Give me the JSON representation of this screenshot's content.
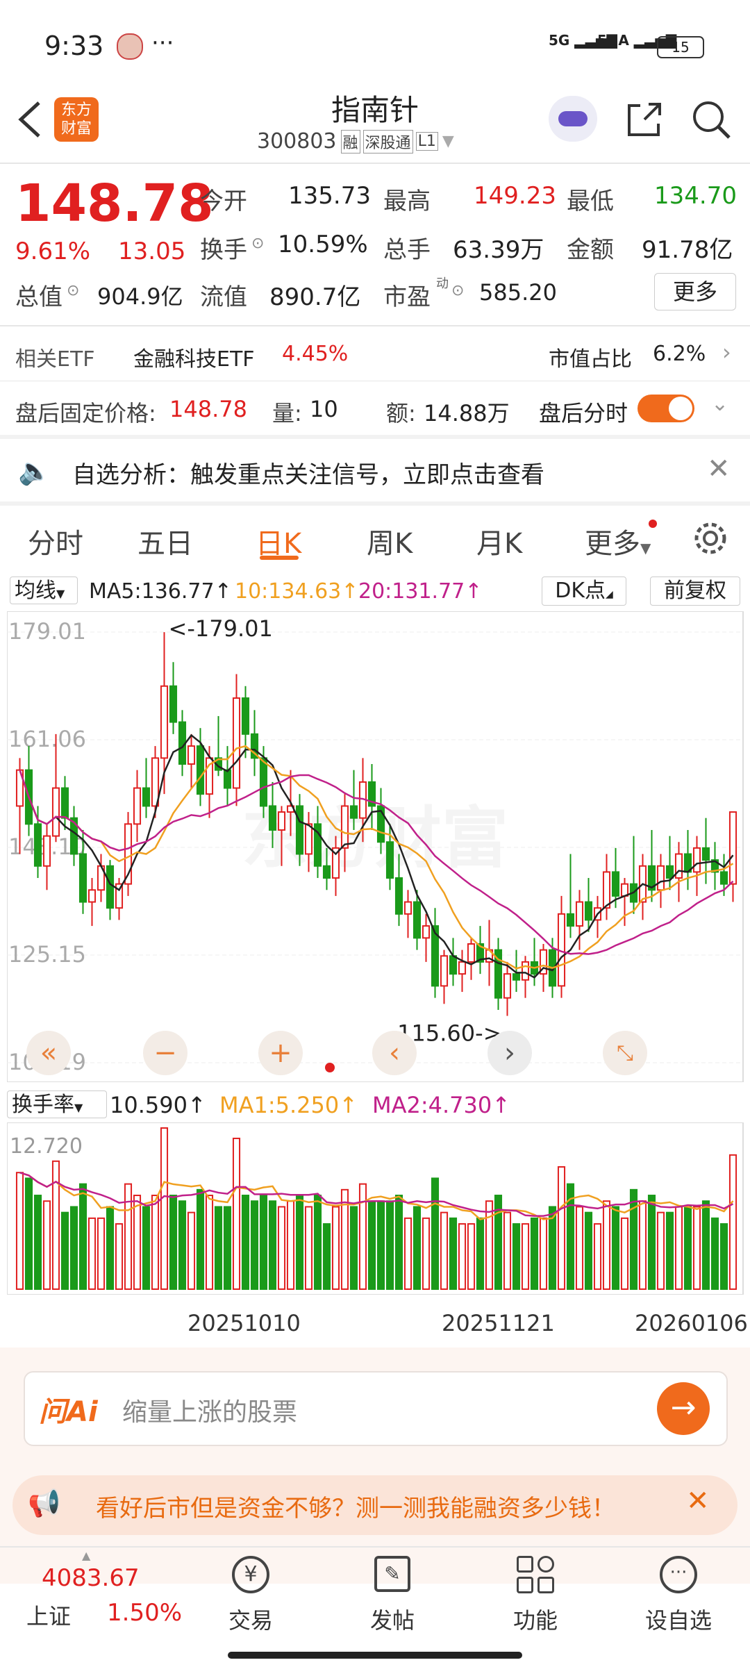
{
  "status_bar": {
    "time": "9:33",
    "dots": "···",
    "battery": "15",
    "net1": "5G",
    "net2": "5GA"
  },
  "header": {
    "logo_line1": "东方",
    "logo_line2": "财富",
    "title": "指南针",
    "code": "300803",
    "tag_rong": "融",
    "tag_market": "深股通",
    "tag_level": "L1"
  },
  "quote": {
    "price": "148.78",
    "change_pct": "9.61%",
    "change": "13.05",
    "open_label": "今开",
    "open": "135.73",
    "high_label": "最高",
    "high": "149.23",
    "low_label": "最低",
    "low": "134.70",
    "turnover_label": "换手",
    "turnover": "10.59%",
    "volume_label": "总手",
    "volume": "63.39万",
    "amount_label": "金额",
    "amount": "91.78亿",
    "mktcap_label": "总值",
    "mktcap": "904.9亿",
    "float_label": "流值",
    "float": "890.7亿",
    "pe_label": "市盈",
    "pe_sup": "动",
    "pe": "585.20",
    "more_button": "更多"
  },
  "etf": {
    "label": "相关ETF",
    "name": "金融科技ETF",
    "pct": "4.45%",
    "ratio_label": "市值占比",
    "ratio": "6.2%"
  },
  "after_hours": {
    "price_label": "盘后固定价格:",
    "price": "148.78",
    "qty_label": "量:",
    "qty": "10",
    "amt_label": "额:",
    "amt": "14.88万",
    "toggle_label": "盘后分时"
  },
  "notice": {
    "text": "自选分析：触发重点关注信号，立即点击查看"
  },
  "tabs": {
    "t1": "分时",
    "t2": "五日",
    "t3": "日K",
    "t4": "周K",
    "t5": "月K",
    "t6": "更多"
  },
  "indicator_bar": {
    "ma_select": "均线",
    "ma5": "MA5:136.77",
    "ma10": "10:134.63",
    "ma20": "20:131.77",
    "dk": "DK点",
    "adjust": "前复权"
  },
  "kline": {
    "y_labels": [
      "179.01",
      "161.06",
      "143.10",
      "125.15",
      "107.19"
    ],
    "max_label": "<-179.01",
    "min_label": "115.60->",
    "watermark": "东方财富"
  },
  "volume_panel": {
    "select": "换手率",
    "value": "10.590",
    "ma1": "MA1:5.250",
    "ma2": "MA2:4.730",
    "y_label": "12.720"
  },
  "x_axis": {
    "d1": "20251010",
    "d2": "20251121",
    "d3": "20260106"
  },
  "ask_ai": {
    "brand": "问Ai",
    "placeholder": "缩量上涨的股票"
  },
  "promo": {
    "text": "看好后市但是资金不够？测一测我能融资多少钱！"
  },
  "bottom_nav": {
    "index_value": "4083.67",
    "index_name": "上证",
    "index_pct": "1.50%",
    "trade": "交易",
    "post": "发帖",
    "func": "功能",
    "watch": "设自选"
  },
  "colors": {
    "up": "#e02020",
    "down": "#1a9a1a",
    "accent": "#f06a1c",
    "ma5": "#222222",
    "ma10": "#f0a020",
    "ma20": "#c0208a"
  },
  "chart_data": {
    "type": "candlestick",
    "title": "",
    "ylim": [
      107.19,
      179.01
    ],
    "y_ticks": [
      179.01,
      161.06,
      143.1,
      125.15,
      107.19
    ],
    "x_ticks": [
      "20251010",
      "20251121",
      "20260106"
    ],
    "annotations": [
      "<-179.01",
      "115.60->"
    ],
    "series_ma": [
      {
        "name": "MA5",
        "last": 136.77
      },
      {
        "name": "MA10",
        "last": 134.63
      },
      {
        "name": "MA20",
        "last": 131.77
      }
    ],
    "candles": [
      [
        150,
        158,
        142,
        156
      ],
      [
        156,
        160,
        145,
        147
      ],
      [
        147,
        150,
        138,
        140
      ],
      [
        140,
        147,
        136,
        145
      ],
      [
        145,
        162,
        144,
        153
      ],
      [
        153,
        155,
        146,
        148
      ],
      [
        148,
        150,
        140,
        142
      ],
      [
        142,
        146,
        132,
        134
      ],
      [
        134,
        138,
        130,
        136
      ],
      [
        136,
        142,
        134,
        140
      ],
      [
        140,
        141,
        131,
        133
      ],
      [
        133,
        138,
        131,
        137
      ],
      [
        137,
        149,
        135,
        147
      ],
      [
        147,
        156,
        144,
        153
      ],
      [
        153,
        158,
        148,
        150
      ],
      [
        150,
        160,
        148,
        158
      ],
      [
        158,
        179,
        152,
        170
      ],
      [
        170,
        174,
        162,
        164
      ],
      [
        164,
        166,
        155,
        157
      ],
      [
        157,
        162,
        153,
        160
      ],
      [
        160,
        163,
        150,
        152
      ],
      [
        152,
        160,
        148,
        158
      ],
      [
        158,
        165,
        155,
        156
      ],
      [
        156,
        160,
        150,
        153
      ],
      [
        153,
        172,
        150,
        168
      ],
      [
        168,
        170,
        158,
        162
      ],
      [
        162,
        166,
        155,
        158
      ],
      [
        158,
        160,
        148,
        150
      ],
      [
        150,
        154,
        143,
        146
      ],
      [
        146,
        150,
        140,
        149
      ],
      [
        149,
        156,
        145,
        150
      ],
      [
        150,
        152,
        140,
        142
      ],
      [
        142,
        149,
        139,
        147
      ],
      [
        147,
        150,
        138,
        140
      ],
      [
        140,
        143,
        136,
        138
      ],
      [
        138,
        145,
        135,
        143
      ],
      [
        143,
        152,
        139,
        150
      ],
      [
        150,
        156,
        146,
        148
      ],
      [
        148,
        158,
        144,
        154
      ],
      [
        154,
        157,
        146,
        150
      ],
      [
        150,
        153,
        142,
        144
      ],
      [
        144,
        147,
        136,
        138
      ],
      [
        138,
        142,
        130,
        132
      ],
      [
        132,
        136,
        128,
        134
      ],
      [
        134,
        136,
        126,
        128
      ],
      [
        128,
        132,
        124,
        130
      ],
      [
        130,
        133,
        118,
        120
      ],
      [
        120,
        126,
        117,
        125
      ],
      [
        125,
        128,
        120,
        122
      ],
      [
        122,
        126,
        119,
        124
      ],
      [
        124,
        128,
        121,
        127
      ],
      [
        127,
        130,
        122,
        124
      ],
      [
        124,
        131,
        120,
        126
      ],
      [
        126,
        128,
        116,
        118
      ],
      [
        118,
        124,
        115,
        122
      ],
      [
        122,
        126,
        119,
        121
      ],
      [
        121,
        125,
        118,
        124
      ],
      [
        124,
        128,
        120,
        122
      ],
      [
        122,
        127,
        119,
        126
      ],
      [
        126,
        128,
        118,
        120
      ],
      [
        120,
        135,
        118,
        132
      ],
      [
        132,
        142,
        128,
        130
      ],
      [
        130,
        136,
        126,
        134
      ],
      [
        134,
        138,
        129,
        131
      ],
      [
        131,
        135,
        128,
        133
      ],
      [
        133,
        142,
        131,
        139
      ],
      [
        139,
        143,
        133,
        135
      ],
      [
        135,
        138,
        130,
        137
      ],
      [
        137,
        145,
        132,
        134
      ],
      [
        134,
        142,
        131,
        140
      ],
      [
        140,
        146,
        134,
        136
      ],
      [
        136,
        142,
        133,
        140
      ],
      [
        140,
        145,
        136,
        138
      ],
      [
        138,
        144,
        134,
        142
      ],
      [
        142,
        146,
        136,
        139
      ],
      [
        139,
        145,
        135,
        143
      ],
      [
        143,
        148,
        137,
        141
      ],
      [
        141,
        144,
        136,
        139
      ],
      [
        139,
        142,
        135,
        137
      ],
      [
        137,
        149,
        134,
        149
      ]
    ],
    "turnover_series": {
      "name": "换手率",
      "ylim": [
        0,
        12.72
      ],
      "last": 10.59,
      "ma1_last": 5.25,
      "ma2_last": 4.73
    }
  }
}
